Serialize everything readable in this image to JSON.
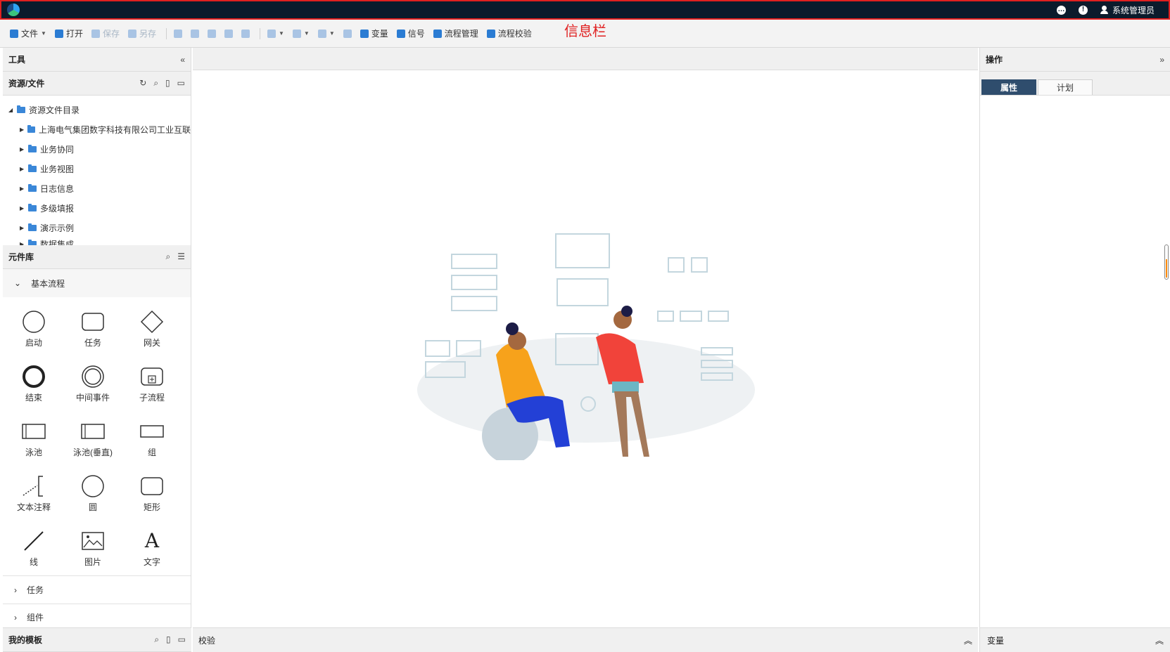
{
  "header": {
    "user_name": "系统管理员",
    "annotation": "信息栏",
    "icons": [
      "chat-icon",
      "alert-icon",
      "user-icon"
    ]
  },
  "toolbar": {
    "file": "文件",
    "open": "打开",
    "save": "保存",
    "save_as": "另存",
    "variable": "变量",
    "signal": "信号",
    "process_manage": "流程管理",
    "process_check": "流程校验"
  },
  "left": {
    "tools_title": "工具",
    "resources_title": "资源/文件",
    "tree_root": "资源文件目录",
    "tree_items": [
      "上海电气集团数字科技有限公司工业互联",
      "业务协同",
      "业务视图",
      "日志信息",
      "多级填报",
      "演示示例",
      "数据集成"
    ],
    "library_title": "元件库",
    "basic_group": "基本流程",
    "components": [
      "启动",
      "任务",
      "网关",
      "结束",
      "中间事件",
      "子流程",
      "泳池",
      "泳池(垂直)",
      "组",
      "文本注释",
      "圆",
      "矩形",
      "线",
      "图片",
      "文字"
    ],
    "task_group": "任务",
    "component_group": "组件",
    "templates_title": "我的模板"
  },
  "canvas": {
    "check_title": "校验"
  },
  "right": {
    "ops_title": "操作",
    "tab_props": "属性",
    "tab_plan": "计划",
    "variables_title": "变量"
  },
  "colors": {
    "header_bg": "#0b1b2c",
    "header_border": "#e02020",
    "accent": "#2b7cd3",
    "active_tab": "#2f4d6d"
  }
}
